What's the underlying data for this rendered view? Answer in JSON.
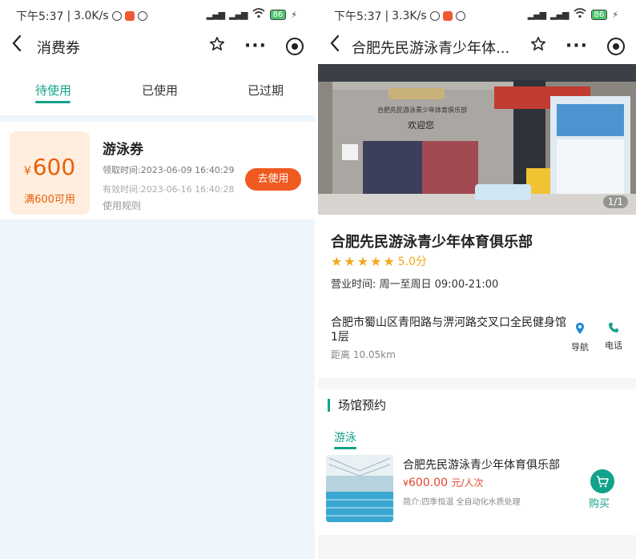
{
  "left_screen": {
    "status": {
      "time": "下午5:37",
      "speed": "3.0K/s",
      "battery": "86"
    },
    "nav": {
      "title": "消费券"
    },
    "tabs": [
      {
        "label": "待使用",
        "active": true
      },
      {
        "label": "已使用",
        "active": false
      },
      {
        "label": "已过期",
        "active": false
      }
    ],
    "coupon": {
      "currency": "¥",
      "amount": "600",
      "condition": "满600可用",
      "name": "游泳券",
      "received": "领取时间:2023-06-09 16:40:29",
      "valid": "有效时间:2023-06-16 16:40:28",
      "rules": "使用规则",
      "use_label": "去使用"
    }
  },
  "right_screen": {
    "status": {
      "time": "下午5:37",
      "speed": "3.3K/s",
      "battery": "86"
    },
    "nav": {
      "title": "合肥先民游泳青少年体..."
    },
    "photo_counter": "1/1",
    "venue": {
      "name": "合肥先民游泳青少年体育俱乐部",
      "rating": "5.0分",
      "rating_stars": 5,
      "hours": "营业时间:  周一至周日 09:00-21:00",
      "address": "合肥市蜀山区青阳路与淠河路交叉口全民健身馆1层",
      "distance": "距离 10.05km",
      "nav_label": "导航",
      "phone_label": "电话"
    },
    "booking": {
      "title": "场馆预约",
      "sport_tab": "游泳",
      "product": {
        "name": "合肥先民游泳青少年体育俱乐部",
        "currency": "¥",
        "price": "600.00",
        "unit": "元/人次",
        "desc": "简介:四季恒温 全自动化水质处理",
        "buy_label": "购买"
      }
    }
  },
  "colors": {
    "accent": "#13a28a",
    "coupon_orange": "#e8600a",
    "use_button": "#ef5a20",
    "price_red": "#e0472b",
    "star": "#f3a81b"
  }
}
